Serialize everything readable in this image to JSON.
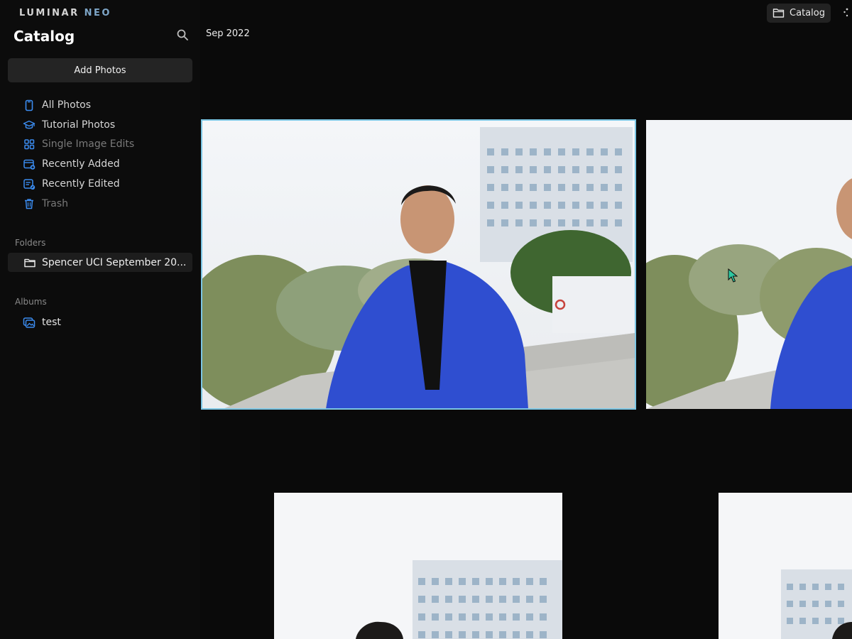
{
  "app": {
    "logo_primary": "LUMINAR",
    "logo_secondary": "NEO",
    "title": "Catalog"
  },
  "sidebar": {
    "add_photos_label": "Add Photos",
    "nav": [
      {
        "label": "All Photos",
        "icon": "phone-icon",
        "dim": false
      },
      {
        "label": "Tutorial Photos",
        "icon": "graduation-cap-icon",
        "dim": false
      },
      {
        "label": "Single Image Edits",
        "icon": "grid-icon",
        "dim": true
      },
      {
        "label": "Recently Added",
        "icon": "calendar-add-icon",
        "dim": false
      },
      {
        "label": "Recently Edited",
        "icon": "edit-list-icon",
        "dim": false
      },
      {
        "label": "Trash",
        "icon": "trash-icon",
        "dim": true
      }
    ],
    "folders_label": "Folders",
    "folders": [
      {
        "label": "Spencer UCI September 20...",
        "icon": "folder-icon"
      }
    ],
    "albums_label": "Albums",
    "albums": [
      {
        "label": "test",
        "icon": "album-icon"
      }
    ]
  },
  "header": {
    "date_group": "Sep 2022",
    "catalog_button_label": "Catalog"
  },
  "colors": {
    "accent": "#3b8cf0",
    "selection": "#7cc6e4",
    "background": "#0a0a0a",
    "sidebar_selected": "#1d1d1d"
  },
  "gallery": {
    "photos": [
      {
        "selected": true
      },
      {
        "selected": false
      },
      {
        "selected": false
      },
      {
        "selected": false
      }
    ]
  }
}
